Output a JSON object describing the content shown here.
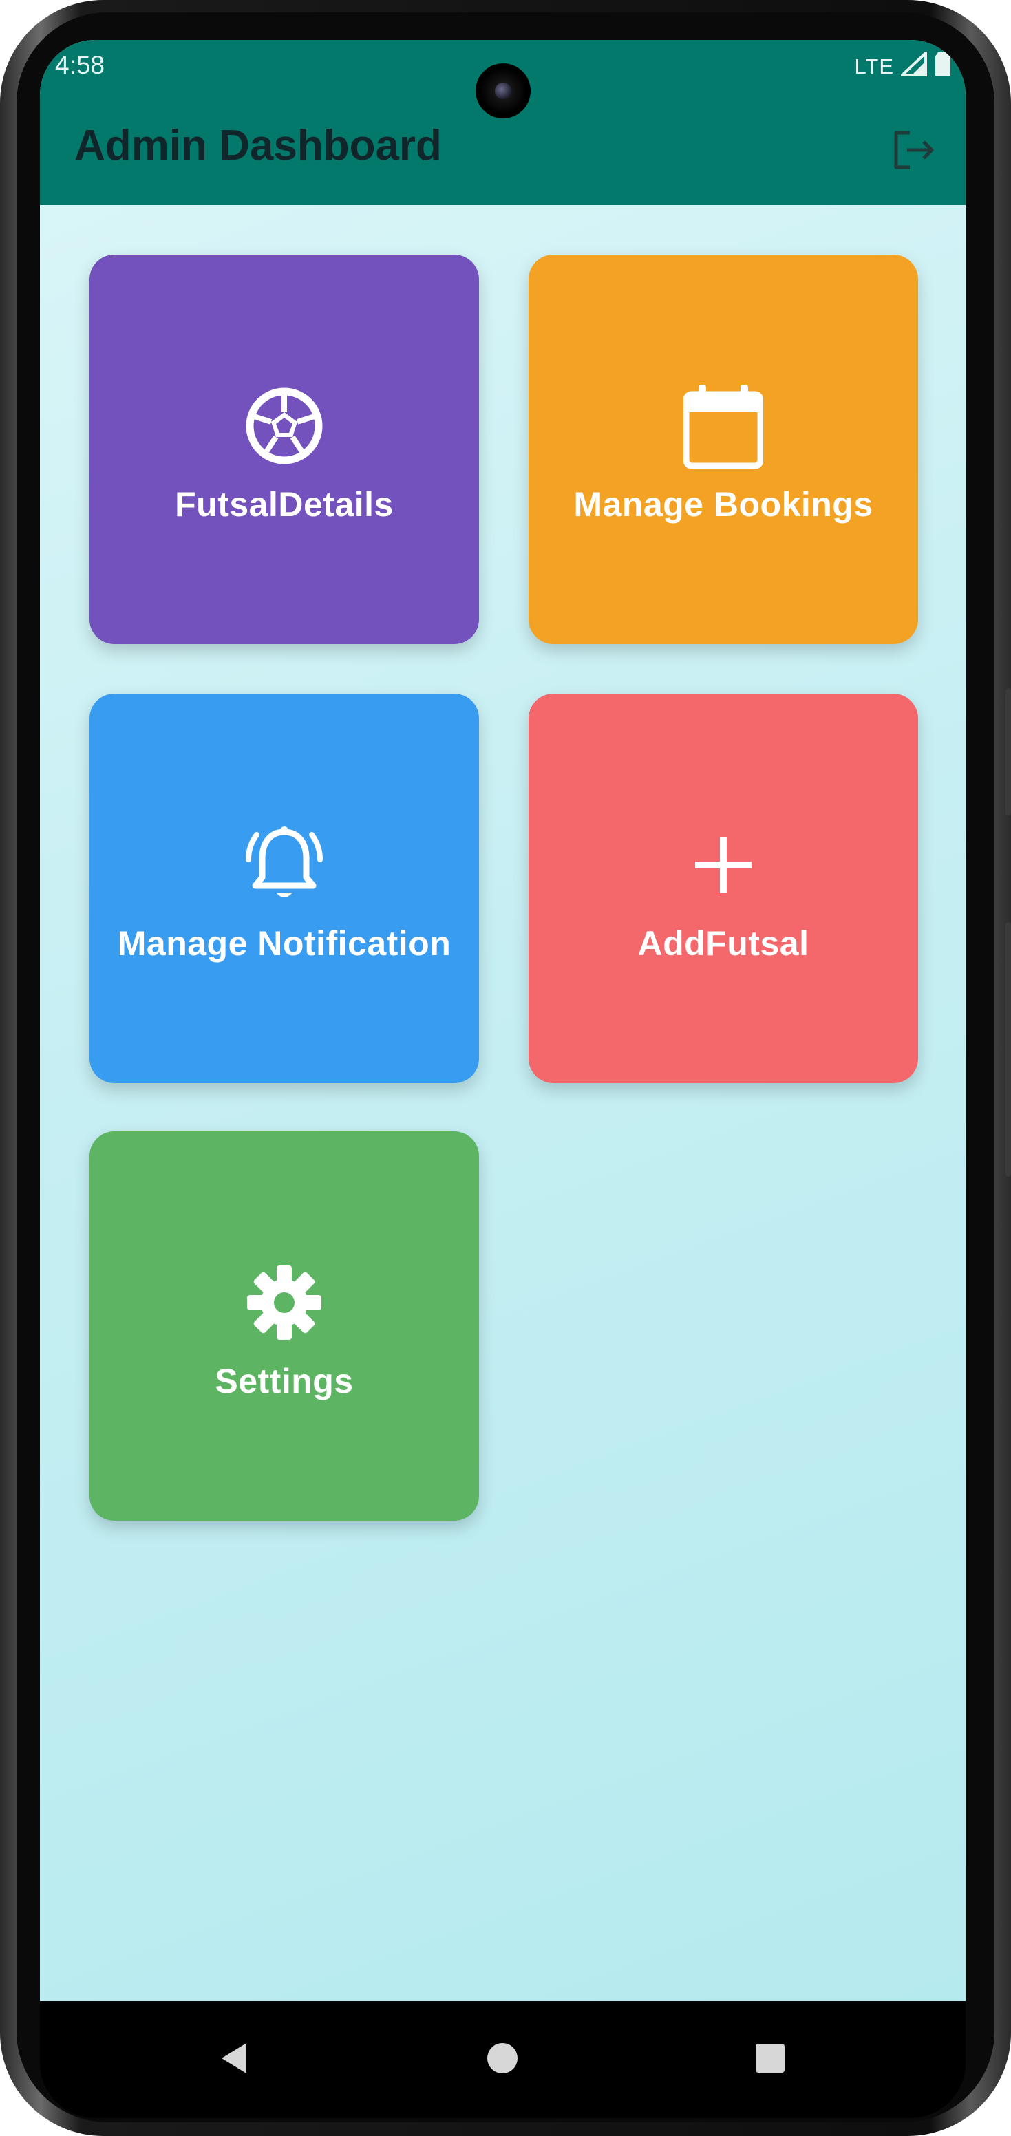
{
  "status_bar": {
    "time": "4:58",
    "network": "LTE"
  },
  "app_bar": {
    "title": "Admin Dashboard",
    "color": "#03796b",
    "actions": [
      {
        "icon": "logout-icon"
      }
    ]
  },
  "tiles": [
    {
      "label": "FutsalDetails",
      "icon": "soccer-ball-icon",
      "color": "#7352bd"
    },
    {
      "label": "Manage Bookings",
      "icon": "calendar-icon",
      "color": "#f4a224"
    },
    {
      "label": "Manage Notification",
      "icon": "bell-ringing-icon",
      "color": "#389cf1"
    },
    {
      "label": "AddFutsal",
      "icon": "plus-icon",
      "color": "#f4676a"
    },
    {
      "label": "Settings",
      "icon": "gear-icon",
      "color": "#5db564"
    }
  ],
  "nav_bar": {
    "buttons": [
      "back-icon",
      "home-icon",
      "recents-icon"
    ]
  }
}
